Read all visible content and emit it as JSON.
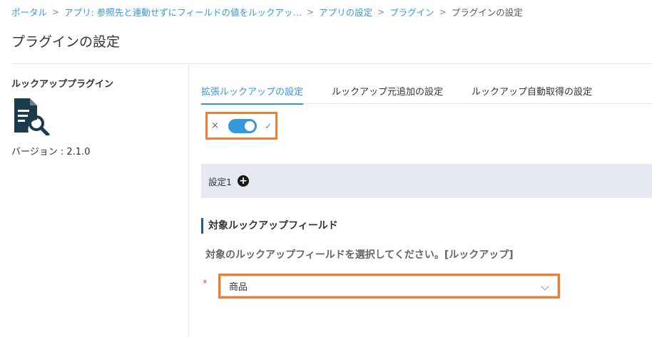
{
  "breadcrumb": {
    "items": [
      {
        "label": "ポータル"
      },
      {
        "label": "アプリ: 参照先と連動せずにフィールドの値をルックアッ…"
      },
      {
        "label": "アプリの設定"
      },
      {
        "label": "プラグイン"
      },
      {
        "label": "プラグインの設定"
      }
    ],
    "separator": ">"
  },
  "page_title": "プラグインの設定",
  "sidebar": {
    "plugin_name": "ルックアッププラグイン",
    "icon": "document-search-icon",
    "version": "バージョン : 2.1.0"
  },
  "tabs": [
    {
      "label": "拡張ルックアップの設定",
      "active": true
    },
    {
      "label": "ルックアップ元追加の設定",
      "active": false
    },
    {
      "label": "ルックアップ自動取得の設定",
      "active": false
    }
  ],
  "toggle": {
    "off_symbol": "×",
    "on_symbol": "✓",
    "enabled": true
  },
  "setting": {
    "label": "設定1",
    "add_symbol": "+"
  },
  "section": {
    "title": "対象ルックアップフィールド",
    "description": "対象のルックアップフィールドを選択してください。[ルックアップ]",
    "required_mark": "*",
    "selected_value": "商品"
  },
  "colors": {
    "accent": "#3498db",
    "highlight": "#ed7d31",
    "section_bar": "#1f5c99",
    "setting_bg": "#e6e9f1"
  }
}
